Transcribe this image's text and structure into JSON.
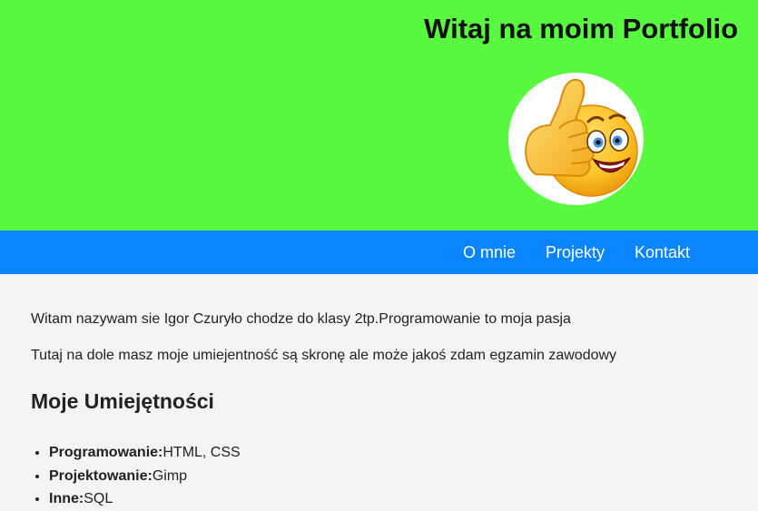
{
  "header": {
    "title": "Witaj na moim Portfolio",
    "avatar_icon": "thumbs-up-smiley-icon",
    "background": "#59f93f"
  },
  "nav": {
    "background": "#0a84ff",
    "items": [
      {
        "label": "O mnie"
      },
      {
        "label": "Projekty"
      },
      {
        "label": "Kontakt"
      }
    ]
  },
  "main": {
    "intro_1": "Witam nazywam sie Igor Czuryło chodze do klasy 2tp.Programowanie to moja pasja",
    "intro_2": "Tutaj na dole masz moje umiejentność są skronę ale może jakoś zdam egzamin zawodowy",
    "skills_heading": "Moje Umiejętności",
    "skills": [
      {
        "name": "Programowanie:",
        "value": "HTML, CSS"
      },
      {
        "name": "Projektowanie:",
        "value": "Gimp"
      },
      {
        "name": "Inne:",
        "value": "SQL"
      }
    ]
  }
}
